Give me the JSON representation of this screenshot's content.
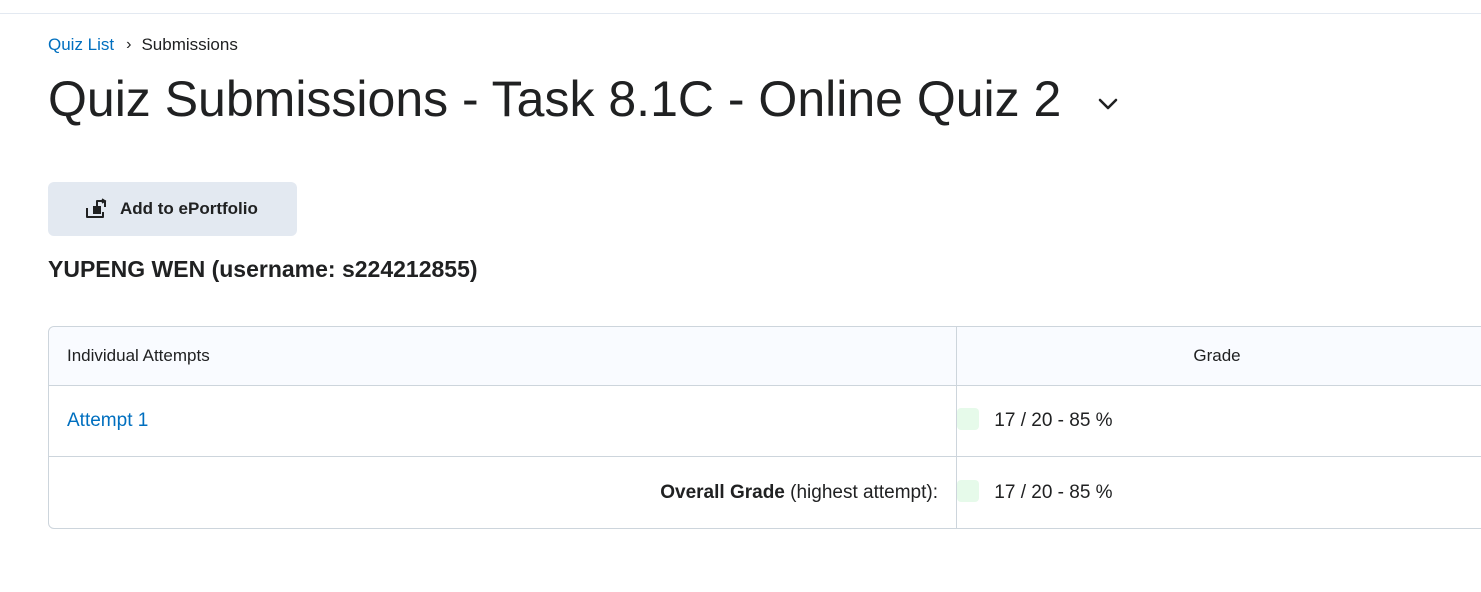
{
  "breadcrumb": {
    "parent": "Quiz List",
    "separator": "›",
    "current": "Submissions"
  },
  "title": "Quiz Submissions - Task 8.1C - Online Quiz 2",
  "title_chevron_icon": "chevron-down-icon",
  "eportfolio_button": {
    "label": "Add to ePortfolio",
    "icon": "eportfolio-add-icon"
  },
  "user_heading": "YUPENG WEN (username: s224212855)",
  "table": {
    "headers": {
      "attempts": "Individual Attempts",
      "grade": "Grade"
    },
    "rows": [
      {
        "attempt": "Attempt 1",
        "grade": "17 / 20 - 85 %",
        "swatch_color": "#e6faea"
      }
    ],
    "overall": {
      "label_bold": "Overall Grade",
      "label_rest": " (highest attempt):",
      "grade": "17 / 20 - 85 %",
      "swatch_color": "#e6faea"
    }
  },
  "colors": {
    "link": "#006fbf",
    "button_bg": "#e3e9f1",
    "header_bg": "#f9fbff",
    "border": "#cdd5dc",
    "text": "#202122"
  }
}
